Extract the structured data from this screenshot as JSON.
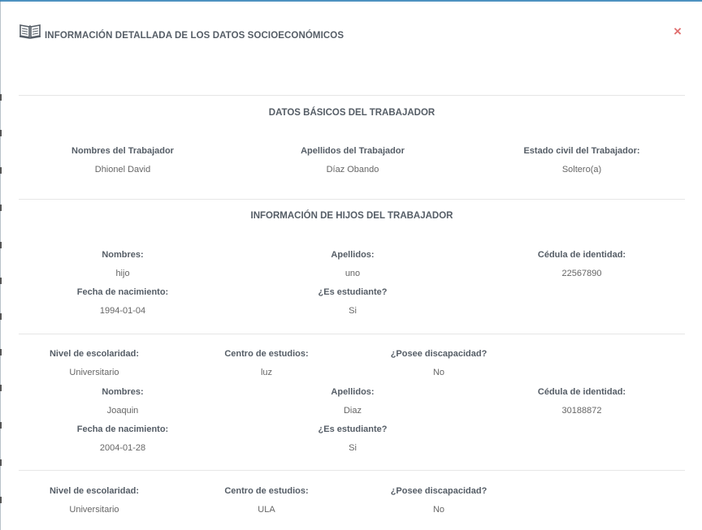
{
  "modal": {
    "title": "INFORMACIÓN DETALLADA DE LOS DATOS SOCIOECONÓMICOS",
    "close_label": "×",
    "header_icon": "open-book-icon"
  },
  "worker": {
    "section_title": "DATOS BÁSICOS DEL TRABAJADOR",
    "labels": {
      "nombres": "Nombres del Trabajador",
      "apellidos": "Apellidos del Trabajador",
      "estado_civil": "Estado civil del Trabajador:"
    },
    "nombres": "Dhionel David",
    "apellidos": "Díaz Obando",
    "estado_civil": "Soltero(a)"
  },
  "children": {
    "section_title": "INFORMACIÓN DE HIJOS DEL TRABAJADOR",
    "labels": {
      "nombres": "Nombres:",
      "apellidos": "Apellidos:",
      "cedula": "Cédula de identidad:",
      "fecha_nacimiento": "Fecha de nacimiento:",
      "es_estudiante": "¿Es estudiante?",
      "nivel_escolaridad": "Nivel de escolaridad:",
      "centro_estudios": "Centro de estudios:",
      "posee_discapacidad": "¿Posee discapacidad?"
    },
    "items": [
      {
        "nombres": "hijo",
        "apellidos": "uno",
        "cedula": "22567890",
        "fecha_nacimiento": "1994-01-04",
        "es_estudiante": "Si",
        "nivel_escolaridad": "Universitario",
        "centro_estudios": "luz",
        "posee_discapacidad": "No"
      },
      {
        "nombres": "Joaquin",
        "apellidos": "Diaz",
        "cedula": "30188872",
        "fecha_nacimiento": "2004-01-28",
        "es_estudiante": "Si",
        "nivel_escolaridad": "Universitario",
        "centro_estudios": "ULA",
        "posee_discapacidad": "No"
      }
    ]
  },
  "colors": {
    "heading": "#555d66",
    "text": "#666666",
    "close": "#e07070",
    "divider": "#e6e6e6"
  }
}
